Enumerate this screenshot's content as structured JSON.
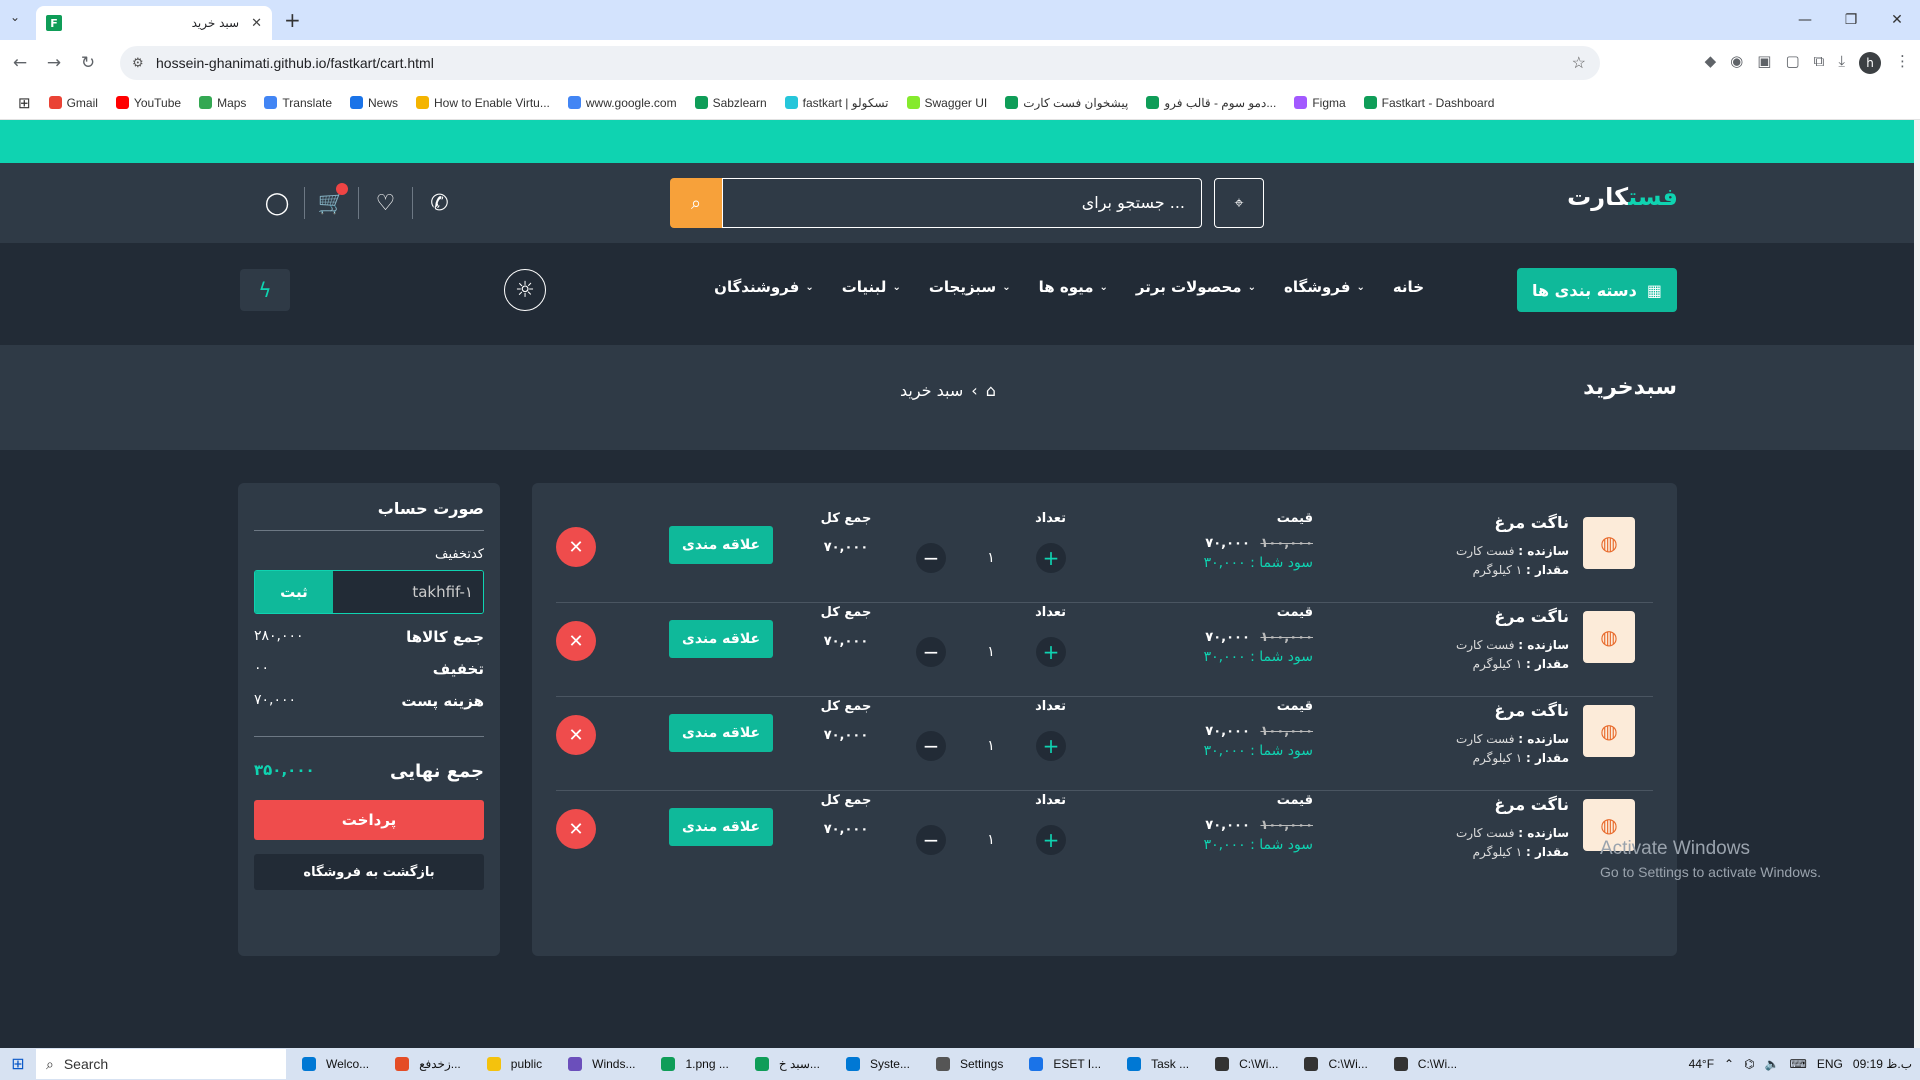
{
  "browser": {
    "tab_title": "سبد خرید",
    "tab_favicon": "F",
    "url": "hossein-ghanimati.github.io/fastkart/cart.html"
  },
  "bookmarks": [
    {
      "label": "Gmail",
      "color": "#ea4335"
    },
    {
      "label": "YouTube",
      "color": "#ff0000"
    },
    {
      "label": "Maps",
      "color": "#34a853"
    },
    {
      "label": "Translate",
      "color": "#4285f4"
    },
    {
      "label": "News",
      "color": "#1a73e8"
    },
    {
      "label": "How to Enable Virtu...",
      "color": "#f4b400"
    },
    {
      "label": "www.google.com",
      "color": "#4285f4"
    },
    {
      "label": "Sabzlearn",
      "color": "#0f9d58"
    },
    {
      "label": "fastkart | تسکولو",
      "color": "#26c6da"
    },
    {
      "label": "Swagger UI",
      "color": "#85ea2d"
    },
    {
      "label": "پیشخوان فست کارت",
      "color": "#0f9d58"
    },
    {
      "label": "دمو سوم - قالب فرو...",
      "color": "#0f9d58"
    },
    {
      "label": "Figma",
      "color": "#a259ff"
    },
    {
      "label": "Fastkart - Dashboard",
      "color": "#0f9d58"
    }
  ],
  "header": {
    "logo_a": "فست",
    "logo_b": "کارت",
    "search_placeholder": "جستجو برای ..."
  },
  "nav": {
    "categories": "دسته بندی ها",
    "items": [
      "خانه",
      "فروشگاه",
      "محصولات برتر",
      "میوه ها",
      "سبزیجات",
      "لبنیات",
      "فروشندگان"
    ]
  },
  "breadcrumb": {
    "title": "سبدخرید",
    "current": "سبد خرید"
  },
  "cart": {
    "labels": {
      "price": "قیمت",
      "qty": "تعداد",
      "total": "جمع کل",
      "maker": "سازنده :",
      "amount": "مقدار :",
      "favorite": "علاقه مندی"
    },
    "items": [
      {
        "name": "ناگت مرغ",
        "maker": "فست کارت",
        "amount": "۱ کیلوگرم",
        "old": "۱۰۰,۰۰۰",
        "price": "۷۰,۰۰۰",
        "save": "سود شما : ۳۰,۰۰۰",
        "qty": "۱",
        "total": "۷۰,۰۰۰"
      },
      {
        "name": "ناگت مرغ",
        "maker": "فست کارت",
        "amount": "۱ کیلوگرم",
        "old": "۱۰۰,۰۰۰",
        "price": "۷۰,۰۰۰",
        "save": "سود شما : ۳۰,۰۰۰",
        "qty": "۱",
        "total": "۷۰,۰۰۰"
      },
      {
        "name": "ناگت مرغ",
        "maker": "فست کارت",
        "amount": "۱ کیلوگرم",
        "old": "۱۰۰,۰۰۰",
        "price": "۷۰,۰۰۰",
        "save": "سود شما : ۳۰,۰۰۰",
        "qty": "۱",
        "total": "۷۰,۰۰۰"
      },
      {
        "name": "ناگت مرغ",
        "maker": "فست کارت",
        "amount": "۱ کیلوگرم",
        "old": "۱۰۰,۰۰۰",
        "price": "۷۰,۰۰۰",
        "save": "سود شما : ۳۰,۰۰۰",
        "qty": "۱",
        "total": "۷۰,۰۰۰"
      }
    ]
  },
  "summary": {
    "title": "صورت حساب",
    "code_label": "کدتخفیف",
    "code_value": "takhfif-۱",
    "code_btn": "ثبت",
    "subtotal_label": "جمع کالاها",
    "subtotal": "۲۸۰,۰۰۰",
    "discount_label": "تخفیف",
    "discount": "۰۰",
    "shipping_label": "هزینه پست",
    "shipping": "۷۰,۰۰۰",
    "grand_label": "جمع نهایی",
    "grand": "۳۵۰,۰۰۰",
    "pay": "پرداخت",
    "back": "بازگشت به فروشگاه"
  },
  "watermark": {
    "line1": "Activate Windows",
    "line2": "Go to Settings to activate Windows."
  },
  "taskbar": {
    "search": "Search",
    "apps": [
      "Welco...",
      "زخدفع...",
      "public",
      "Winds...",
      "1.png ...",
      "سبد خ...",
      "Syste...",
      "Settings",
      "ESET I...",
      "Task ...",
      "C:\\Wi...",
      "C:\\Wi...",
      "C:\\Wi..."
    ],
    "temp": "44°F",
    "lang": "ENG",
    "time": "09:19 ب.ظ"
  },
  "colors": {
    "accent": "#0fd3b1",
    "search_button": "#f7a13a",
    "danger": "#ef4c4c",
    "panel": "#2f3a46",
    "bg": "#222b36"
  }
}
